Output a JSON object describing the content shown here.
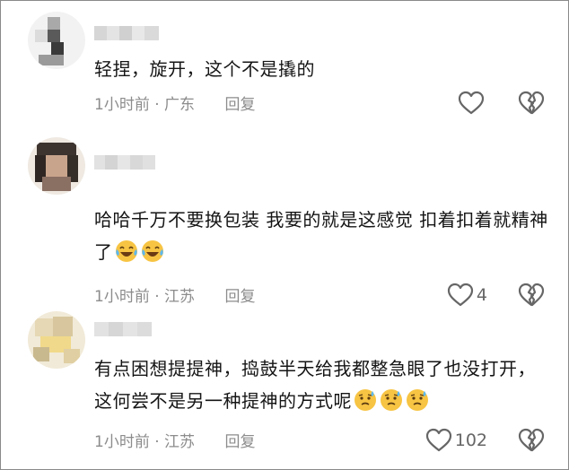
{
  "comments": [
    {
      "text": "轻捏，旋开，这个不是撬的",
      "emojis": [],
      "time": "1小时前",
      "location": "广东",
      "reply_label": "回复",
      "like_count": ""
    },
    {
      "text": "哈哈千万不要换包装 我要的就是这感觉 扣着扣着就精神了",
      "emojis": [
        "tears-of-joy-emoji",
        "tears-of-joy-emoji"
      ],
      "time": "1小时前",
      "location": "江苏",
      "reply_label": "回复",
      "like_count": "4"
    },
    {
      "text": "有点困想提提神，捣鼓半天给我都整急眼了也没打开，这何尝不是另一种提神的方式呢",
      "emojis": [
        "sweat-emoji",
        "sweat-emoji",
        "sweat-emoji"
      ],
      "time": "1小时前",
      "location": "江苏",
      "reply_label": "回复",
      "like_count": "102"
    }
  ],
  "separator": " · ",
  "icons": {
    "like": "heart-outline-icon",
    "dislike": "broken-heart-outline-icon"
  },
  "colors": {
    "text": "#151515",
    "meta": "#8c8c8c",
    "icon": "#666666",
    "emoji_face": "#f7c443"
  }
}
